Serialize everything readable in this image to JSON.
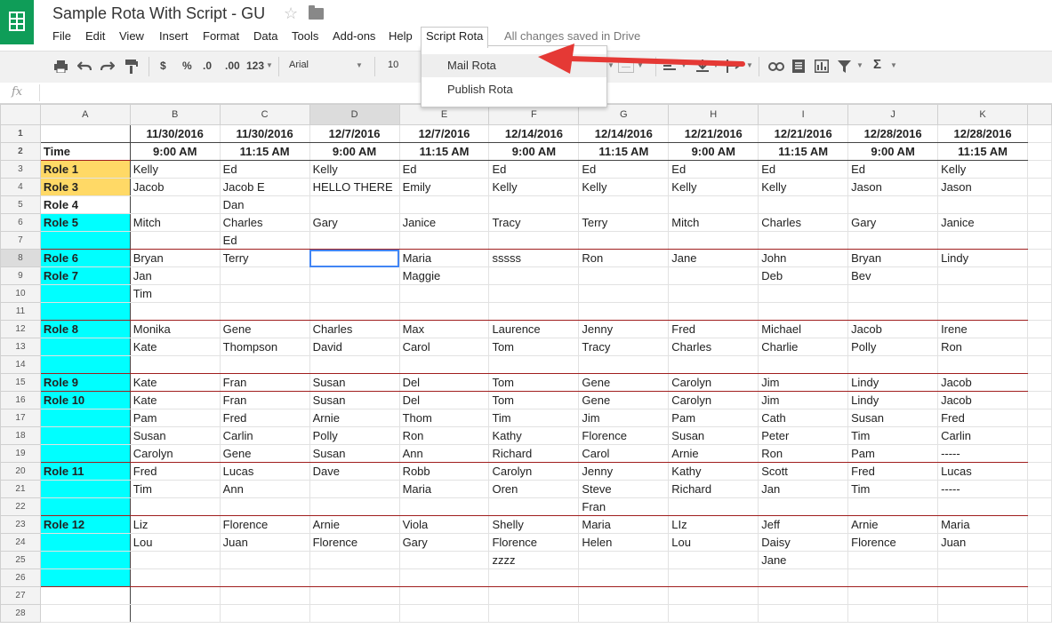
{
  "app": {
    "title": "Sample Rota With Script - GU",
    "star_icon": "star-icon",
    "folder_icon": "folder-icon"
  },
  "menu": {
    "items": [
      "File",
      "Edit",
      "View",
      "Insert",
      "Format",
      "Data",
      "Tools",
      "Add-ons",
      "Help",
      "Script Rota"
    ],
    "active": "Script Rota",
    "saved_status": "All changes saved in Drive"
  },
  "toolbar": {
    "currency": "$",
    "percent": "%",
    "dec_less": ".0",
    "dec_more": ".00",
    "more_formats": "123",
    "font": "Arial",
    "font_size": "10"
  },
  "formula_bar": {
    "fx": "fx",
    "value": ""
  },
  "dropdown": {
    "items": [
      "Mail Rota",
      "Publish Rota"
    ]
  },
  "grid": {
    "columns": [
      "A",
      "B",
      "C",
      "D",
      "E",
      "F",
      "G",
      "H",
      "I",
      "J",
      "K"
    ],
    "selected_column": "D",
    "selected_row": 8,
    "rows": [
      [
        "",
        "11/30/2016",
        "11/30/2016",
        "12/7/2016",
        "12/7/2016",
        "12/14/2016",
        "12/14/2016",
        "12/21/2016",
        "12/21/2016",
        "12/28/2016",
        "12/28/2016"
      ],
      [
        "Time",
        "9:00 AM",
        "11:15 AM",
        "9:00 AM",
        "11:15 AM",
        "9:00 AM",
        "11:15 AM",
        "9:00 AM",
        "11:15 AM",
        "9:00 AM",
        "11:15 AM"
      ],
      [
        "Role 1",
        "Kelly",
        "Ed",
        "Kelly",
        "Ed",
        "Ed",
        "Ed",
        "Ed",
        "Ed",
        "Ed",
        "Kelly"
      ],
      [
        "Role 3",
        "Jacob",
        "Jacob E",
        "HELLO THERE",
        "Emily",
        "Kelly",
        "Kelly",
        "Kelly",
        "Kelly",
        "Jason",
        "Jason"
      ],
      [
        "Role 4",
        "",
        "Dan",
        "",
        "",
        "",
        "",
        "",
        "",
        "",
        ""
      ],
      [
        "Role 5",
        "Mitch",
        "Charles",
        "Gary",
        "Janice",
        "Tracy",
        " Terry",
        "Mitch",
        "Charles",
        "Gary",
        "Janice"
      ],
      [
        "",
        "",
        "Ed",
        "",
        "",
        "",
        "",
        "",
        "",
        "",
        ""
      ],
      [
        "Role 6",
        "Bryan",
        " Terry",
        "",
        "Maria",
        "sssss",
        "Ron",
        "Jane",
        "John",
        "Bryan",
        "Lindy"
      ],
      [
        "Role 7",
        "Jan",
        "",
        "",
        "Maggie",
        "",
        "",
        "",
        "Deb",
        "Bev",
        ""
      ],
      [
        "",
        "Tim",
        "",
        "",
        "",
        "",
        "",
        "",
        "",
        "",
        ""
      ],
      [
        "",
        "",
        "",
        "",
        "",
        "",
        "",
        "",
        "",
        "",
        ""
      ],
      [
        "Role 8",
        "Monika",
        "Gene",
        "Charles",
        "Max",
        "Laurence",
        "Jenny",
        "Fred",
        "Michael",
        "Jacob",
        "Irene"
      ],
      [
        "",
        "Kate",
        "Thompson",
        "David",
        "Carol",
        "Tom",
        "Tracy",
        "Charles",
        "Charlie",
        "Polly",
        "Ron"
      ],
      [
        "",
        "",
        "",
        "",
        "",
        "",
        "",
        "",
        "",
        "",
        ""
      ],
      [
        "Role 9",
        "Kate",
        "Fran",
        "Susan",
        "Del",
        "Tom",
        "Gene",
        "Carolyn",
        "Jim",
        "Lindy",
        "Jacob"
      ],
      [
        "Role 10",
        "Kate",
        "Fran",
        "Susan",
        "Del",
        "Tom",
        "Gene",
        "Carolyn",
        "Jim",
        "Lindy",
        "Jacob"
      ],
      [
        "",
        "Pam",
        "Fred",
        "Arnie",
        "Thom",
        "Tim",
        "Jim",
        "Pam",
        "Cath",
        "Susan",
        "Fred"
      ],
      [
        "",
        "Susan",
        "Carlin",
        "Polly",
        "Ron",
        "Kathy",
        "Florence",
        "Susan",
        "Peter",
        "Tim",
        "Carlin"
      ],
      [
        "",
        "Carolyn",
        "Gene",
        "Susan",
        "Ann",
        "Richard",
        "Carol",
        "Arnie",
        "Ron",
        "Pam",
        "-----"
      ],
      [
        "Role 11",
        "Fred",
        "Lucas",
        "Dave",
        "Robb",
        "Carolyn",
        "Jenny",
        "Kathy",
        "Scott",
        "Fred",
        "Lucas"
      ],
      [
        "",
        "Tim",
        "Ann",
        "",
        "Maria",
        "Oren",
        "Steve",
        "Richard",
        "Jan",
        "Tim",
        "-----"
      ],
      [
        "",
        "",
        "",
        "",
        "",
        "",
        "Fran",
        "",
        "",
        "",
        ""
      ],
      [
        "Role 12",
        "Liz",
        "Florence",
        "Arnie",
        "Viola",
        "Shelly",
        "Maria",
        "LIz",
        "Jeff",
        "Arnie",
        "Maria"
      ],
      [
        "",
        "Lou",
        "Juan",
        "Florence",
        "Gary",
        "Florence",
        "Helen",
        "Lou",
        "Daisy",
        "Florence",
        "Juan"
      ],
      [
        "",
        "",
        "",
        "",
        "",
        "zzzz",
        "",
        "",
        "Jane",
        "",
        ""
      ],
      [
        "",
        "",
        "",
        "",
        "",
        "",
        "",
        "",
        "",
        "",
        ""
      ],
      [
        "",
        "",
        "",
        "",
        "",
        "",
        "",
        "",
        "",
        "",
        ""
      ],
      [
        "",
        "",
        "",
        "",
        "",
        "",
        "",
        "",
        "",
        "",
        ""
      ]
    ],
    "role_colors": {
      "yellow": "#ffd966",
      "cyan": "#00ffff"
    }
  },
  "colors": {
    "sheets_green": "#0f9d58",
    "arrow_red": "#e53935",
    "section_line": "#a01e1e",
    "selection_blue": "#4285f4"
  }
}
